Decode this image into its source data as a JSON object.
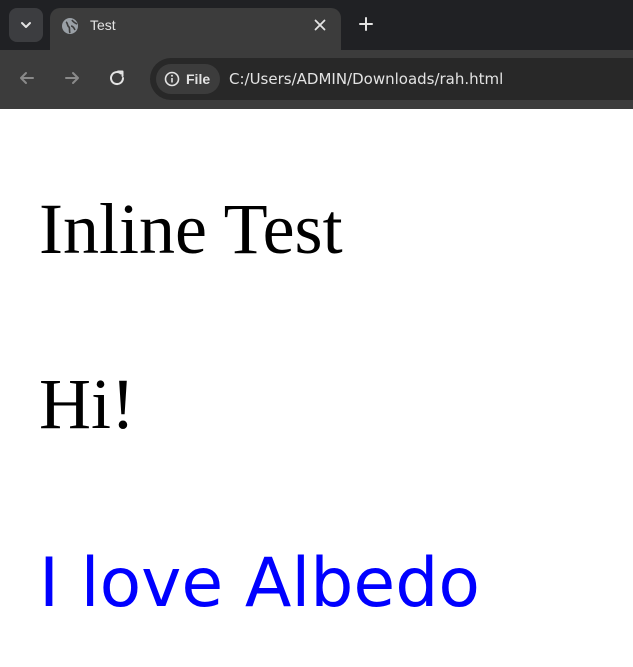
{
  "browser": {
    "tab": {
      "title": "Test",
      "favicon_icon": "globe-icon",
      "close_icon": "close-icon"
    },
    "tab_search_icon": "chevron-down-icon",
    "new_tab_icon": "plus-icon",
    "toolbar": {
      "back_icon": "back-arrow-icon",
      "forward_icon": "forward-arrow-icon",
      "reload_icon": "reload-icon",
      "site_info_icon": "info-icon",
      "site_chip_label": "File",
      "url": "C:/Users/ADMIN/Downloads/rah.html"
    },
    "colors": {
      "tab_strip": "#202124",
      "toolbar": "#3c3c3c",
      "omnibox": "#282828",
      "text_light": "#e3e3e3"
    }
  },
  "page": {
    "heading_1": "Inline Test",
    "heading_2": "Hi!",
    "blue_line": "I love Albedo",
    "colors": {
      "text": "#000000",
      "blue": "#0000ff",
      "background": "#ffffff"
    }
  }
}
